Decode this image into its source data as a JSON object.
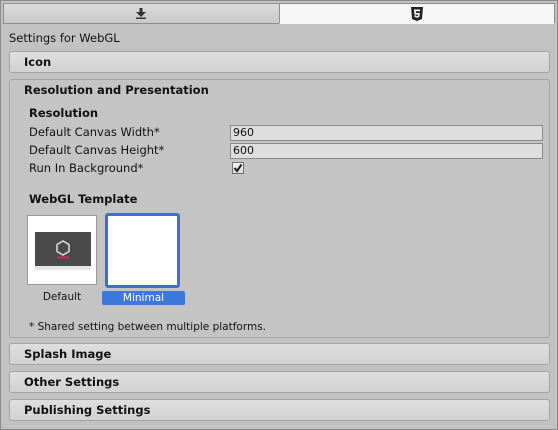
{
  "tabs": [
    {
      "name": "standalone-tab",
      "icon": "download-arrow-icon",
      "active": false
    },
    {
      "name": "webgl-tab",
      "icon": "html5-icon",
      "active": true
    }
  ],
  "settings_title": "Settings for WebGL",
  "sections": {
    "icon": "Icon",
    "resolution": "Resolution and Presentation",
    "splash": "Splash Image",
    "other": "Other Settings",
    "publishing": "Publishing Settings"
  },
  "resolution": {
    "subheader": "Resolution",
    "width_label": "Default Canvas Width*",
    "width_value": "960",
    "height_label": "Default Canvas Height*",
    "height_value": "600",
    "background_label": "Run In Background*",
    "background_checked": true
  },
  "webgl_template": {
    "header": "WebGL Template",
    "options": [
      {
        "label": "Default",
        "selected": false
      },
      {
        "label": "Minimal",
        "selected": true
      }
    ]
  },
  "footnote": "* Shared setting between multiple platforms.",
  "colors": {
    "selection": "#3d79dd",
    "panel": "#c2c2c2"
  }
}
